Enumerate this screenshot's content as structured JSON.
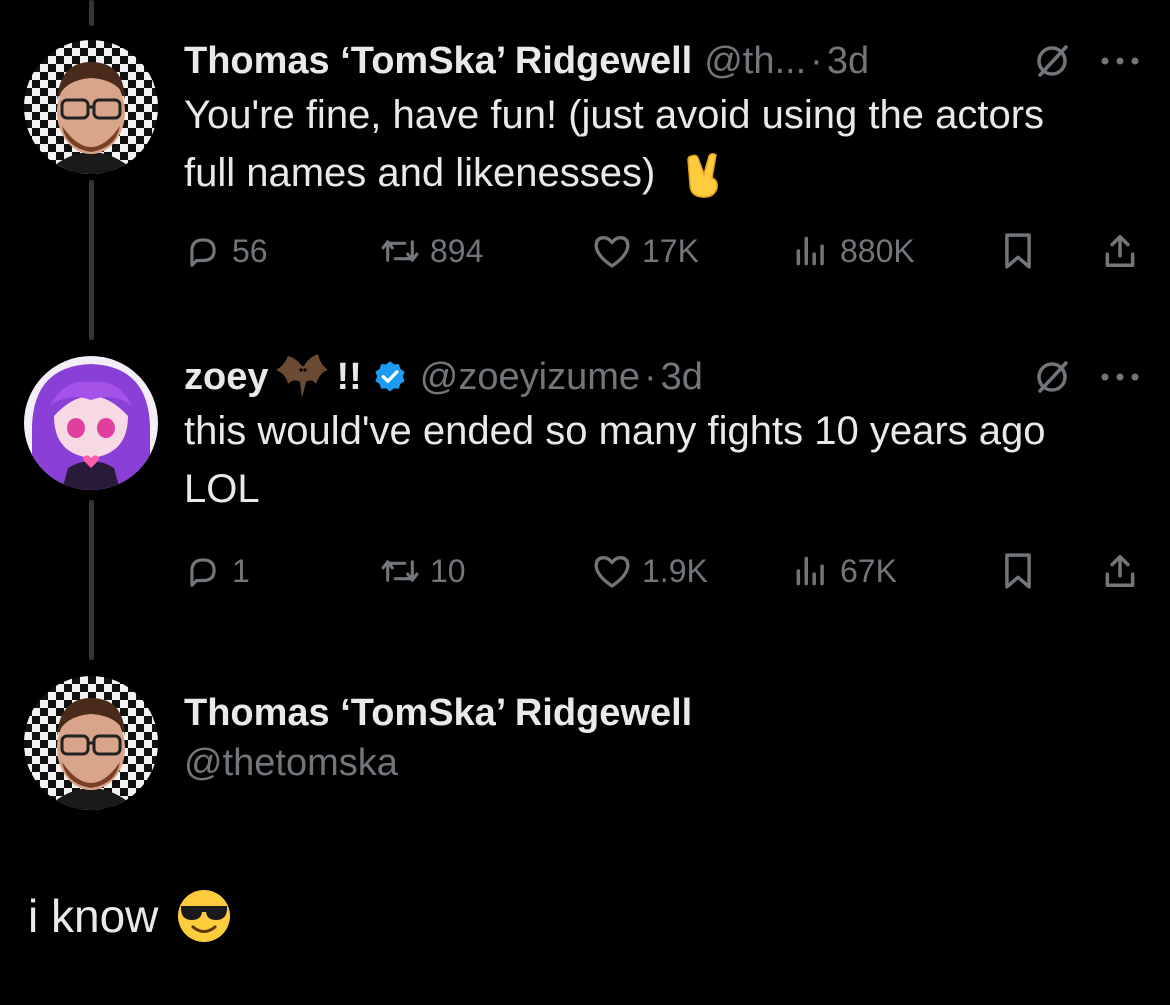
{
  "posts": [
    {
      "name": "Thomas ‘TomSka’ Ridgewell",
      "handle": "@th...",
      "time": "3d",
      "text": "You're fine, have fun! (just avoid using the actors full names and likenesses)",
      "stats": {
        "replies": "56",
        "reposts": "894",
        "likes": "17K",
        "views": "880K"
      }
    },
    {
      "name": "zoey",
      "name_suffix": "!!",
      "handle": "@zoeyizume",
      "time": "3d",
      "text": "this would've ended so many fights 10 years ago LOL",
      "stats": {
        "replies": "1",
        "reposts": "10",
        "likes": "1.9K",
        "views": "67K"
      }
    }
  ],
  "main_post": {
    "name": "Thomas ‘TomSka’ Ridgewell",
    "handle": "@thetomska",
    "text": "i know"
  },
  "colors": {
    "background": "#000000",
    "text": "#e7e9ea",
    "secondary": "#71767b",
    "thread_line": "#333639",
    "verified": "#1d9bf0"
  }
}
